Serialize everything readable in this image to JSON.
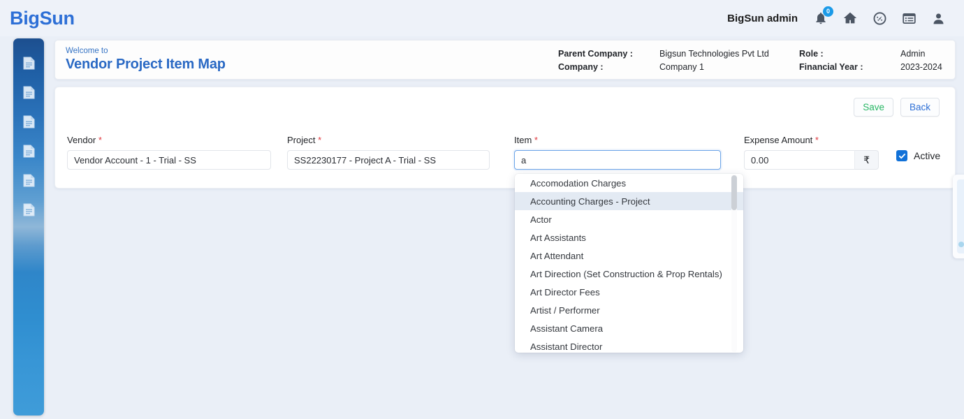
{
  "header": {
    "brand": "BigSun",
    "admin_label": "BigSun admin",
    "notification_count": "0",
    "icons": [
      {
        "name": "bell-icon",
        "label": "Notifications"
      },
      {
        "name": "home-icon",
        "label": "Home"
      },
      {
        "name": "dashboard-icon",
        "label": "Dashboard"
      },
      {
        "name": "list-icon",
        "label": "Reports"
      },
      {
        "name": "user-icon",
        "label": "Profile"
      }
    ]
  },
  "sidebar": {
    "items": [
      {
        "name": "sidebar-item-1",
        "icon": "document-icon"
      },
      {
        "name": "sidebar-item-2",
        "icon": "document-icon"
      },
      {
        "name": "sidebar-item-3",
        "icon": "document-icon"
      },
      {
        "name": "sidebar-item-4",
        "icon": "document-icon"
      },
      {
        "name": "sidebar-item-5",
        "icon": "document-icon"
      },
      {
        "name": "sidebar-item-6",
        "icon": "document-icon"
      }
    ]
  },
  "welcome": {
    "sub": "Welcome to",
    "title": "Vendor Project Item Map",
    "meta": {
      "parent_company_label": "Parent Company :",
      "parent_company_value": "Bigsun Technologies Pvt Ltd",
      "company_label": "Company :",
      "company_value": "Company 1",
      "role_label": "Role :",
      "role_value": "Admin",
      "financial_year_label": "Financial Year :",
      "financial_year_value": "2023-2024"
    }
  },
  "toolbar": {
    "save_label": "Save",
    "back_label": "Back"
  },
  "form": {
    "vendor": {
      "label": "Vendor",
      "required_mark": "*",
      "value": "Vendor Account - 1 - Trial - SS",
      "placeholder": "Vendor"
    },
    "project": {
      "label": "Project",
      "required_mark": "*",
      "value": "SS22230177 - Project A - Trial - SS",
      "placeholder": "Project"
    },
    "item": {
      "label": "Item",
      "required_mark": "*",
      "value": "a",
      "placeholder": "Item"
    },
    "expense_amount": {
      "label": "Expense Amount",
      "required_mark": "*",
      "value": "0.00",
      "placeholder": "0.00",
      "currency_symbol": "₹"
    },
    "active": {
      "label": "Active",
      "checked": true
    }
  },
  "dropdown": {
    "highlighted_index": 1,
    "options": [
      "Accomodation Charges",
      "Accounting Charges - Project",
      "Actor",
      "Art Assistants",
      "Art Attendant",
      "Art Direction (Set Construction & Prop Rentals)",
      "Art Director Fees",
      "Artist / Performer",
      "Assistant Camera",
      "Assistant Director"
    ]
  },
  "colors": {
    "brand_blue": "#2d6fd6",
    "save_green": "#27b664",
    "required_red": "#e0383e",
    "accent_blue": "#1171d8",
    "page_bg": "#eaeff7"
  }
}
